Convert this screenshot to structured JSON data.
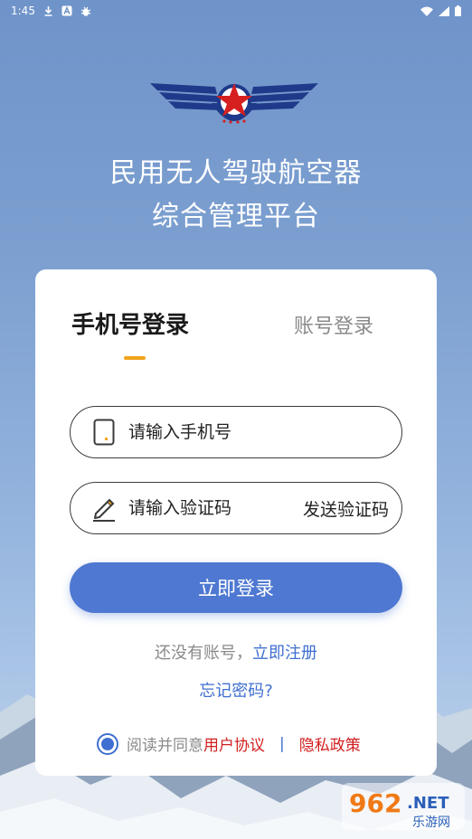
{
  "status_bar": {
    "time": "1:45",
    "left_icons": [
      "download-icon",
      "app-a-icon",
      "bug-icon"
    ],
    "right_icons": [
      "wifi-icon",
      "signal-icon",
      "battery-icon"
    ]
  },
  "header": {
    "title_line1": "民用无人驾驶航空器",
    "title_line2": "综合管理平台",
    "logo_icon": "wings-star-emblem-icon"
  },
  "tabs": [
    {
      "label": "手机号登录",
      "active": true
    },
    {
      "label": "账号登录",
      "active": false
    }
  ],
  "form": {
    "phone_placeholder": "请输入手机号",
    "code_placeholder": "请输入验证码",
    "send_code_label": "发送验证码",
    "login_label": "立即登录"
  },
  "register": {
    "prompt": "还没有账号，",
    "link": "立即注册"
  },
  "forgot_password": "忘记密码?",
  "agreement": {
    "prefix": "阅读并同意",
    "user_agreement": "用户协议",
    "separator": "|",
    "privacy_policy": "隐私政策",
    "checked": true
  },
  "watermark": {
    "text_top": "962",
    "text_net": ".NET",
    "text_cn": "乐游网"
  },
  "colors": {
    "primary": "#4e78d1",
    "link": "#3f6fd0",
    "accent": "#f0a41c",
    "agreement_link": "#d21f1f"
  }
}
